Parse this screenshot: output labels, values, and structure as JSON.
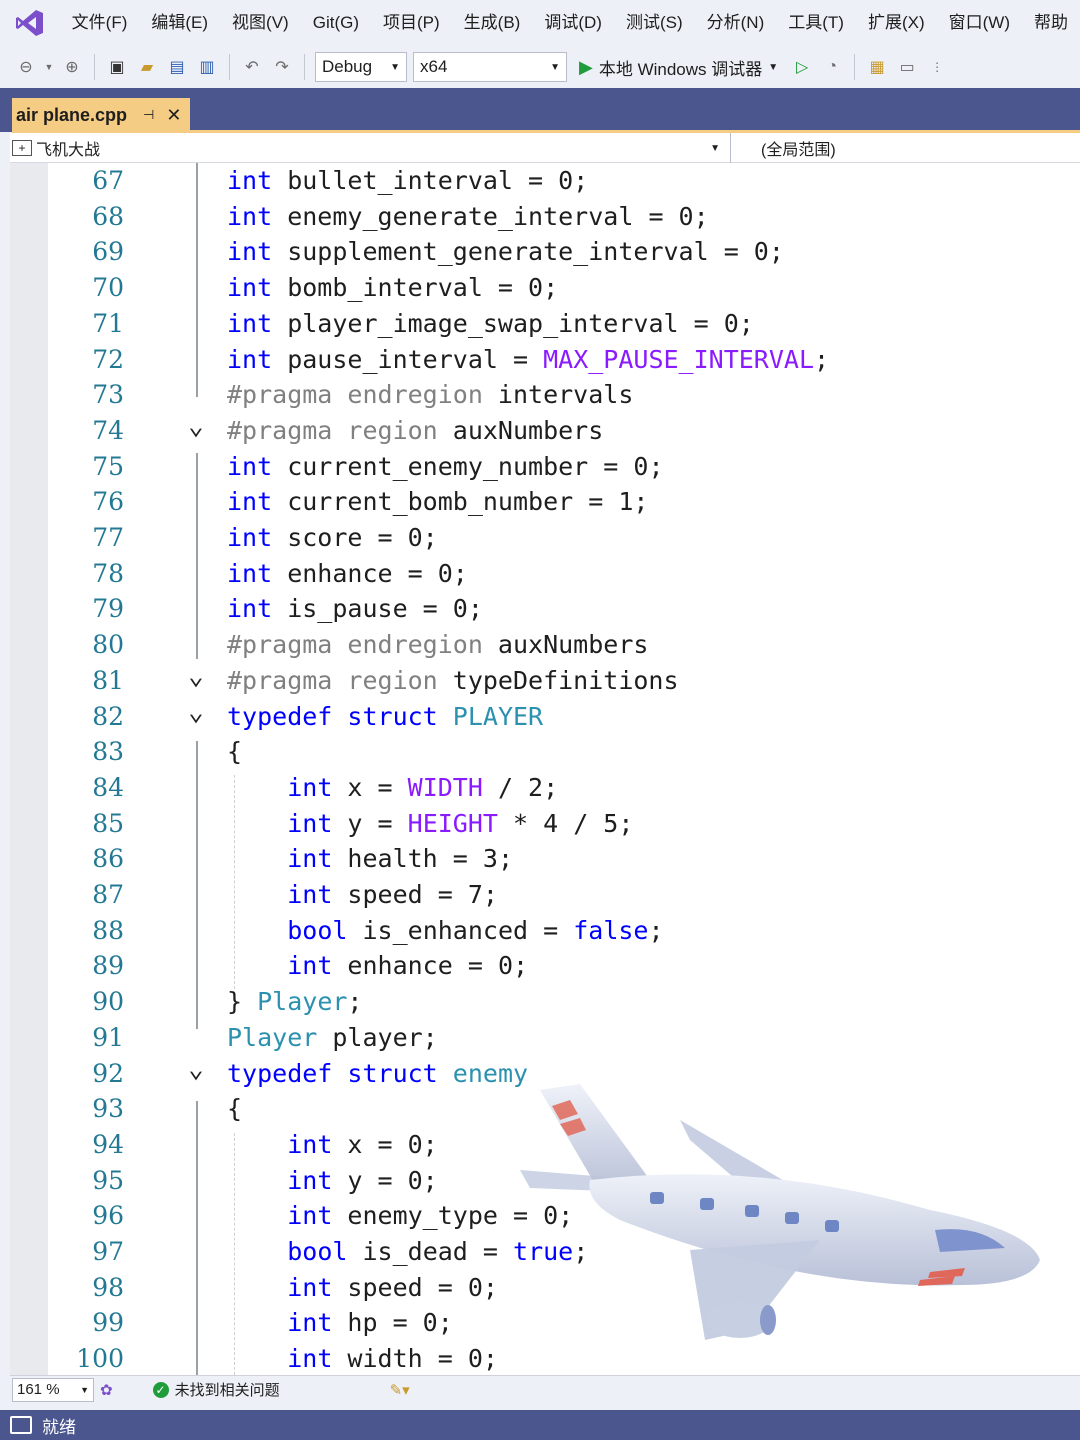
{
  "menu": {
    "items": [
      "文件(F)",
      "编辑(E)",
      "视图(V)",
      "Git(G)",
      "项目(P)",
      "生成(B)",
      "调试(D)",
      "测试(S)",
      "分析(N)",
      "工具(T)",
      "扩展(X)",
      "窗口(W)",
      "帮助"
    ]
  },
  "toolbar": {
    "config": "Debug",
    "platform": "x64",
    "run_label": "本地 Windows 调试器"
  },
  "tab": {
    "filename": "air plane.cpp"
  },
  "navbar": {
    "project": "飞机大战",
    "scope": "(全局范围)"
  },
  "colors": {
    "keyword": "#0000ff",
    "type": "#2b91af",
    "macro": "#8a1bff",
    "preprocessor": "#808080",
    "line_number": "#237893",
    "accent": "#4b568f",
    "active_tab": "#f5cc84"
  },
  "code_lines": [
    {
      "num": "67",
      "tokens": [
        [
          "kw",
          "int"
        ],
        [
          "id",
          " bullet_interval = 0;"
        ]
      ]
    },
    {
      "num": "68",
      "tokens": [
        [
          "kw",
          "int"
        ],
        [
          "id",
          " enemy_generate_interval = 0;"
        ]
      ]
    },
    {
      "num": "69",
      "tokens": [
        [
          "kw",
          "int"
        ],
        [
          "id",
          " supplement_generate_interval = 0;"
        ]
      ]
    },
    {
      "num": "70",
      "tokens": [
        [
          "kw",
          "int"
        ],
        [
          "id",
          " bomb_interval = 0;"
        ]
      ]
    },
    {
      "num": "71",
      "tokens": [
        [
          "kw",
          "int"
        ],
        [
          "id",
          " player_image_swap_interval = 0;"
        ]
      ]
    },
    {
      "num": "72",
      "tokens": [
        [
          "kw",
          "int"
        ],
        [
          "id",
          " pause_interval = "
        ],
        [
          "macro",
          "MAX_PAUSE_INTERVAL"
        ],
        [
          "id",
          ";"
        ]
      ]
    },
    {
      "num": "73",
      "tokens": [
        [
          "pp",
          "#pragma endregion"
        ],
        [
          "id",
          " intervals"
        ]
      ]
    },
    {
      "num": "74",
      "tokens": [
        [
          "pp",
          "#pragma region"
        ],
        [
          "id",
          " auxNumbers"
        ]
      ]
    },
    {
      "num": "75",
      "tokens": [
        [
          "kw",
          "int"
        ],
        [
          "id",
          " current_enemy_number = 0;"
        ]
      ]
    },
    {
      "num": "76",
      "tokens": [
        [
          "kw",
          "int"
        ],
        [
          "id",
          " current_bomb_number = 1;"
        ]
      ]
    },
    {
      "num": "77",
      "tokens": [
        [
          "kw",
          "int"
        ],
        [
          "id",
          " score = 0;"
        ]
      ]
    },
    {
      "num": "78",
      "tokens": [
        [
          "kw",
          "int"
        ],
        [
          "id",
          " enhance = 0;"
        ]
      ]
    },
    {
      "num": "79",
      "tokens": [
        [
          "kw",
          "int"
        ],
        [
          "id",
          " is_pause = 0;"
        ]
      ]
    },
    {
      "num": "80",
      "tokens": [
        [
          "pp",
          "#pragma endregion"
        ],
        [
          "id",
          " auxNumbers"
        ]
      ]
    },
    {
      "num": "81",
      "tokens": [
        [
          "pp",
          "#pragma region"
        ],
        [
          "id",
          " typeDefinitions"
        ]
      ]
    },
    {
      "num": "82",
      "tokens": [
        [
          "kw",
          "typedef"
        ],
        [
          "id",
          " "
        ],
        [
          "kw",
          "struct"
        ],
        [
          "id",
          " "
        ],
        [
          "type",
          "PLAYER"
        ]
      ]
    },
    {
      "num": "83",
      "tokens": [
        [
          "id",
          "{"
        ]
      ]
    },
    {
      "num": "84",
      "tokens": [
        [
          "id",
          "    "
        ],
        [
          "kw",
          "int"
        ],
        [
          "id",
          " x = "
        ],
        [
          "macro",
          "WIDTH"
        ],
        [
          "id",
          " / 2;"
        ]
      ]
    },
    {
      "num": "85",
      "tokens": [
        [
          "id",
          "    "
        ],
        [
          "kw",
          "int"
        ],
        [
          "id",
          " y = "
        ],
        [
          "macro",
          "HEIGHT"
        ],
        [
          "id",
          " * 4 / 5;"
        ]
      ]
    },
    {
      "num": "86",
      "tokens": [
        [
          "id",
          "    "
        ],
        [
          "kw",
          "int"
        ],
        [
          "id",
          " health = 3;"
        ]
      ]
    },
    {
      "num": "87",
      "tokens": [
        [
          "id",
          "    "
        ],
        [
          "kw",
          "int"
        ],
        [
          "id",
          " speed = 7;"
        ]
      ]
    },
    {
      "num": "88",
      "tokens": [
        [
          "id",
          "    "
        ],
        [
          "kw",
          "bool"
        ],
        [
          "id",
          " is_enhanced = "
        ],
        [
          "kw",
          "false"
        ],
        [
          "id",
          ";"
        ]
      ]
    },
    {
      "num": "89",
      "tokens": [
        [
          "id",
          "    "
        ],
        [
          "kw",
          "int"
        ],
        [
          "id",
          " enhance = 0;"
        ]
      ]
    },
    {
      "num": "90",
      "tokens": [
        [
          "id",
          "} "
        ],
        [
          "type",
          "Player"
        ],
        [
          "id",
          ";"
        ]
      ]
    },
    {
      "num": "91",
      "tokens": [
        [
          "type",
          "Player"
        ],
        [
          "id",
          " player;"
        ]
      ]
    },
    {
      "num": "92",
      "tokens": [
        [
          "kw",
          "typedef"
        ],
        [
          "id",
          " "
        ],
        [
          "kw",
          "struct"
        ],
        [
          "id",
          " "
        ],
        [
          "type",
          "enemy"
        ]
      ]
    },
    {
      "num": "93",
      "tokens": [
        [
          "id",
          "{"
        ]
      ]
    },
    {
      "num": "94",
      "tokens": [
        [
          "id",
          "    "
        ],
        [
          "kw",
          "int"
        ],
        [
          "id",
          " x = 0;"
        ]
      ]
    },
    {
      "num": "95",
      "tokens": [
        [
          "id",
          "    "
        ],
        [
          "kw",
          "int"
        ],
        [
          "id",
          " y = 0;"
        ]
      ]
    },
    {
      "num": "96",
      "tokens": [
        [
          "id",
          "    "
        ],
        [
          "kw",
          "int"
        ],
        [
          "id",
          " enemy_type = 0;"
        ]
      ]
    },
    {
      "num": "97",
      "tokens": [
        [
          "id",
          "    "
        ],
        [
          "kw",
          "bool"
        ],
        [
          "id",
          " is_dead = "
        ],
        [
          "kw",
          "true"
        ],
        [
          "id",
          ";"
        ]
      ]
    },
    {
      "num": "98",
      "tokens": [
        [
          "id",
          "    "
        ],
        [
          "kw",
          "int"
        ],
        [
          "id",
          " speed = 0;"
        ]
      ]
    },
    {
      "num": "99",
      "tokens": [
        [
          "id",
          "    "
        ],
        [
          "kw",
          "int"
        ],
        [
          "id",
          " hp = 0;"
        ]
      ]
    },
    {
      "num": "100",
      "tokens": [
        [
          "id",
          "    "
        ],
        [
          "kw",
          "int"
        ],
        [
          "id",
          " width = 0;"
        ]
      ]
    }
  ],
  "fold_markers": [
    "74",
    "81",
    "82",
    "92"
  ],
  "editor_status": {
    "zoom": "161 %",
    "issues": "未找到相关问题"
  },
  "statusbar": {
    "message": "就绪"
  }
}
